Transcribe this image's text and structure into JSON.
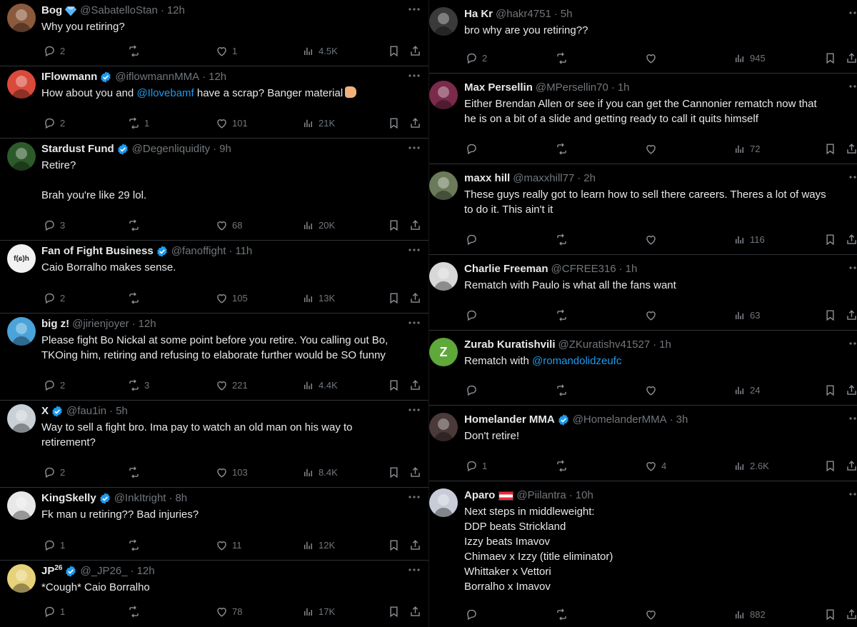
{
  "left": [
    {
      "name": "Bog",
      "badge": "diamond",
      "handle": "@SabatelloStan",
      "time": "12h",
      "text": "Why you retiring?",
      "replies": "2",
      "retweets": "",
      "likes": "1",
      "views": "4.5K",
      "avatar_color": "#8b5a3c"
    },
    {
      "name": "IFlowmann",
      "badge": "verified",
      "handle": "@iflowmannMMA",
      "time": "12h",
      "text_before": "How about you and ",
      "mention": "@Ilovebamf",
      "text_after": " have a scrap? Banger material",
      "emoji": true,
      "replies": "2",
      "retweets": "1",
      "likes": "101",
      "views": "21K",
      "avatar_color": "#d94a3a"
    },
    {
      "name": "Stardust Fund",
      "badge": "verified",
      "handle": "@Degenliquidity",
      "time": "9h",
      "text": "Retire?\n\nBrah you're like 29 lol.",
      "replies": "3",
      "retweets": "",
      "likes": "68",
      "views": "20K",
      "avatar_color": "#2d5a2a"
    },
    {
      "name": "Fan of Fight Business",
      "badge": "verified",
      "handle": "@fanoffight",
      "time": "11h",
      "text": "Caio Borralho makes sense.",
      "replies": "2",
      "retweets": "",
      "likes": "105",
      "views": "13K",
      "avatar_color": "#f2f2f2",
      "avatar_label": "f(ɕ)h"
    },
    {
      "name": "big z!",
      "badge": "",
      "handle": "@jirienjoyer",
      "time": "12h",
      "text": "Please fight Bo Nickal at some point before you retire. You calling out Bo,\nTKOing him, retiring and refusing to elaborate further would be SO funny",
      "replies": "2",
      "retweets": "3",
      "likes": "221",
      "views": "4.4K",
      "avatar_color": "#4aa3d9"
    },
    {
      "name": "X",
      "badge": "verified",
      "handle": "@fau1in",
      "time": "5h",
      "text": "Way to sell a fight bro. Ima pay to watch an old man on his way to\nretirement?",
      "replies": "2",
      "retweets": "",
      "likes": "103",
      "views": "8.4K",
      "avatar_color": "#c9d1d6"
    },
    {
      "name": "KingSkelly",
      "badge": "verified",
      "handle": "@InkItright",
      "time": "8h",
      "text": "Fk man u retiring?? Bad injuries?",
      "replies": "1",
      "retweets": "",
      "likes": "11",
      "views": "12K",
      "avatar_color": "#e8e8e8"
    },
    {
      "name": "JP",
      "name_sup": "26",
      "badge": "verified",
      "handle": "@_JP26_",
      "time": "12h",
      "text": "*Cough* Caio Borralho",
      "replies": "1",
      "retweets": "",
      "likes": "78",
      "views": "17K",
      "avatar_color": "#e6d27a"
    }
  ],
  "right": [
    {
      "name": "Ha Kr",
      "badge": "",
      "handle": "@hakr4751",
      "time": "5h",
      "text": "bro why are you retiring??",
      "replies": "2",
      "retweets": "",
      "likes": "",
      "views": "945",
      "avatar_color": "#3a3a3a"
    },
    {
      "name": "Max Persellin",
      "badge": "",
      "handle": "@MPersellin70",
      "time": "1h",
      "text": "Either Brendan Allen or see if you can get the Cannonier rematch now that\nhe is on a bit of a slide and getting ready to call it quits himself",
      "replies": "",
      "retweets": "",
      "likes": "",
      "views": "72",
      "avatar_color": "#7a2a4a"
    },
    {
      "name": "maxx hill",
      "badge": "",
      "handle": "@maxxhill77",
      "time": "2h",
      "text": "These guys really got to learn how to sell there careers. Theres a lot of ways\nto do it. This ain't it",
      "replies": "",
      "retweets": "",
      "likes": "",
      "views": "116",
      "avatar_color": "#6a7a5a"
    },
    {
      "name": "Charlie Freeman",
      "badge": "",
      "handle": "@CFREE316",
      "time": "1h",
      "text": "Rematch with Paulo is what all the fans want",
      "replies": "",
      "retweets": "",
      "likes": "",
      "views": "63",
      "avatar_color": "#d8d8d8"
    },
    {
      "name": "Zurab Kuratishvili",
      "badge": "",
      "handle": "@ZKuratishv41527",
      "time": "1h",
      "text_before": "Rematch with ",
      "mention": "@romandolidzeufc",
      "text_after": "",
      "replies": "",
      "retweets": "",
      "likes": "",
      "views": "24",
      "avatar_color": "#5fa83a",
      "avatar_label": "Z"
    },
    {
      "name": "Homelander MMA",
      "badge": "verified",
      "handle": "@HomelanderMMA",
      "time": "3h",
      "text": "Don't retire!",
      "replies": "1",
      "retweets": "",
      "likes": "4",
      "views": "2.6K",
      "avatar_color": "#4a3a3a"
    },
    {
      "name": "Aparo",
      "badge": "flag",
      "handle": "@Piilantra",
      "time": "10h",
      "text": "Next steps in middleweight:\nDDP beats Strickland\nIzzy beats Imavov\nChimaev x Izzy (title eliminator)\nWhittaker x Vettori\nBorralho x Imavov",
      "replies": "",
      "retweets": "",
      "likes": "",
      "views": "882",
      "avatar_color": "#c8ccd8"
    }
  ],
  "colors": {
    "background": "#000000",
    "text": "#e7e9ea",
    "muted": "#71767b",
    "accent": "#1d9bf0",
    "divider": "#2f3336"
  }
}
